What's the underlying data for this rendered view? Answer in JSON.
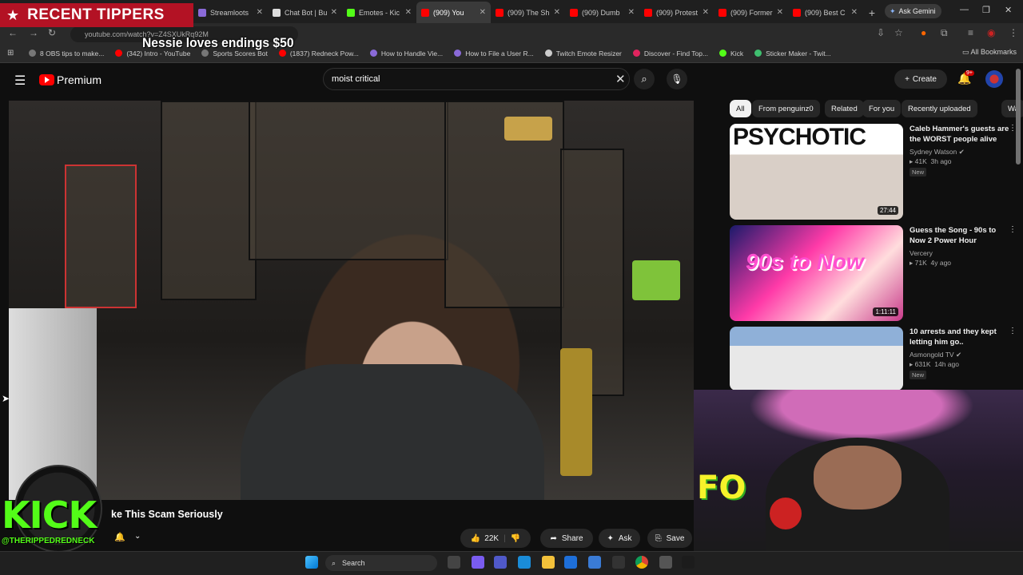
{
  "browser": {
    "tabs": [
      {
        "label": "Streamloots",
        "color": "#8a6ad8"
      },
      {
        "label": "Chat Bot | Bu",
        "color": "#dddddd"
      },
      {
        "label": "Emotes - Kic",
        "color": "#53fc18"
      },
      {
        "label": "(909) You",
        "color": "#ff0000",
        "active": true
      },
      {
        "label": "(909) The Sh",
        "color": "#ff0000"
      },
      {
        "label": "(909) Dumb",
        "color": "#ff0000"
      },
      {
        "label": "(909) Protest",
        "color": "#ff0000"
      },
      {
        "label": "(909) Former",
        "color": "#ff0000"
      },
      {
        "label": "(909) Best C",
        "color": "#ff0000"
      }
    ],
    "new_tab_symbol": "+",
    "ask_gemini": "Ask Gemini",
    "url": "youtube.com/watch?v=Z4SXUkRq92M",
    "bookmarks": [
      {
        "label": "8 OBS tips to make...",
        "color": "#777777"
      },
      {
        "label": "(342) Intro - YouTube",
        "color": "#ff0000"
      },
      {
        "label": "Sports Scores Bot",
        "color": "#777777"
      },
      {
        "label": "(1837) Redneck Pow...",
        "color": "#ff0000"
      },
      {
        "label": "How to Handle Vie...",
        "color": "#8a6ad8"
      },
      {
        "label": "How to File a User R...",
        "color": "#8a6ad8"
      },
      {
        "label": "Twitch Emote Resizer",
        "color": "#cccccc"
      },
      {
        "label": "Discover - Find Top...",
        "color": "#e0245e"
      },
      {
        "label": "Kick",
        "color": "#53fc18"
      },
      {
        "label": "Sticker Maker - Twit...",
        "color": "#3fbf6f"
      }
    ],
    "all_bookmarks": "All Bookmarks"
  },
  "overlay": {
    "recent_tippers": "RECENT TIPPERS",
    "tip_message": "Nessie loves endings $50",
    "kick_logo": "KICK",
    "kick_handle": "@THERIPPEDREDNECK",
    "webcam_text": "FO"
  },
  "youtube": {
    "brand": "Premium",
    "search_query": "moist critical",
    "create_label": "Create",
    "notification_badge": "9+",
    "video_title": "ke This Scam Seriously",
    "actions": {
      "like_count": "22K",
      "share": "Share",
      "ask": "Ask",
      "save": "Save"
    },
    "chips": [
      "All",
      "From penguinz0",
      "Related",
      "For you",
      "Recently uploaded",
      "Wa"
    ],
    "recommendations": [
      {
        "title": "Caleb Hammer's guests are the WORST people alive",
        "channel": "Sydney Watson",
        "verified": true,
        "views": "41K",
        "age": "3h ago",
        "badge": "New",
        "duration": "27:44",
        "thumb_text": "PSYCHOTIC"
      },
      {
        "title": "Guess the Song - 90s to Now 2 Power Hour",
        "channel": "Vercery",
        "verified": false,
        "views": "71K",
        "age": "4y ago",
        "badge": "",
        "duration": "1:11:11",
        "thumb_text": "90s to Now"
      },
      {
        "title": "10 arrests and they kept letting him go..",
        "channel": "Asmongold TV",
        "verified": true,
        "views": "631K",
        "age": "14h ago",
        "badge": "New",
        "duration": "",
        "thumb_text": ""
      }
    ]
  },
  "taskbar": {
    "search_placeholder": "Search"
  }
}
